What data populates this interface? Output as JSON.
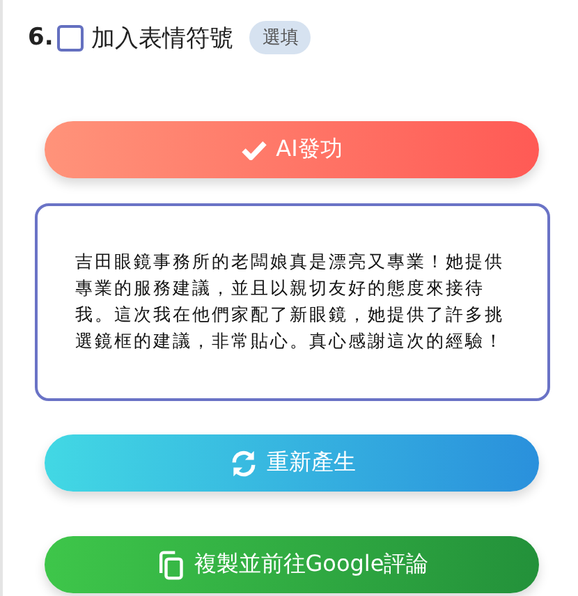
{
  "question": {
    "number": "6.",
    "label": "加入表情符號",
    "checked": false,
    "badge": "選填"
  },
  "buttons": [
    {
      "kind": "generate",
      "label": "AI發功"
    },
    {
      "kind": "review",
      "text": "吉田眼鏡事務所的老闆娘真是漂亮又專業！她提供專業的服務建議，並且以親切友好的態度來接待我。這次我在他們家配了新眼鏡，她提供了許多挑選鏡框的建議，非常貼心。真心感謝這次的經驗！"
    },
    {
      "kind": "regenerate",
      "label": "重新產生"
    },
    {
      "kind": "copy",
      "label": "複製並前往Google評論"
    }
  ]
}
